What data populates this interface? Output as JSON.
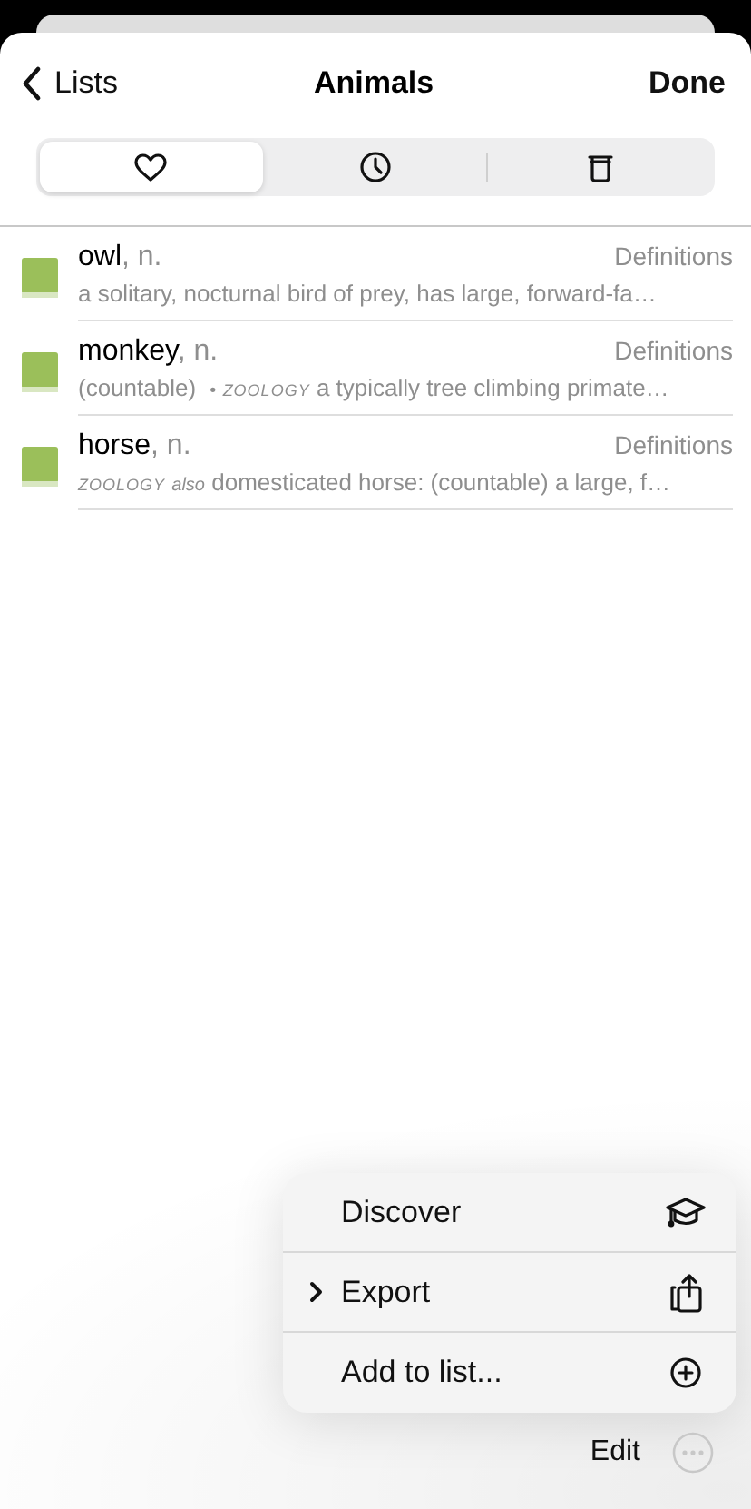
{
  "nav": {
    "back": "Lists",
    "title": "Animals",
    "done": "Done"
  },
  "tabs": [
    {
      "kind": "heart",
      "selected": true
    },
    {
      "kind": "clock",
      "selected": false
    },
    {
      "kind": "trash",
      "selected": false
    }
  ],
  "entries": [
    {
      "word": "owl",
      "pos": ", n.",
      "source": "Definitions",
      "definition": [
        {
          "kind": "text",
          "text": "a solitary, nocturnal bird of prey, has large, forward-fa…"
        }
      ]
    },
    {
      "word": "monkey",
      "pos": ", n.",
      "source": "Definitions",
      "definition": [
        {
          "kind": "text",
          "text": "(countable)"
        },
        {
          "kind": "bullet",
          "text": "•"
        },
        {
          "kind": "label",
          "text": "ZOOLOGY"
        },
        {
          "kind": "text",
          "text": "a typically tree climbing primate…"
        }
      ]
    },
    {
      "word": "horse",
      "pos": ", n.",
      "source": "Definitions",
      "definition": [
        {
          "kind": "label",
          "text": "ZOOLOGY"
        },
        {
          "kind": "note",
          "text": "also"
        },
        {
          "kind": "text",
          "text": "domesticated horse: (countable) a large, f…"
        }
      ]
    }
  ],
  "menu": [
    {
      "label": "Discover",
      "kind": "discover",
      "submenu": false
    },
    {
      "label": "Export",
      "kind": "export",
      "submenu": true
    },
    {
      "label": "Add to list...",
      "kind": "add",
      "submenu": false
    }
  ],
  "bottom": {
    "edit": "Edit"
  }
}
